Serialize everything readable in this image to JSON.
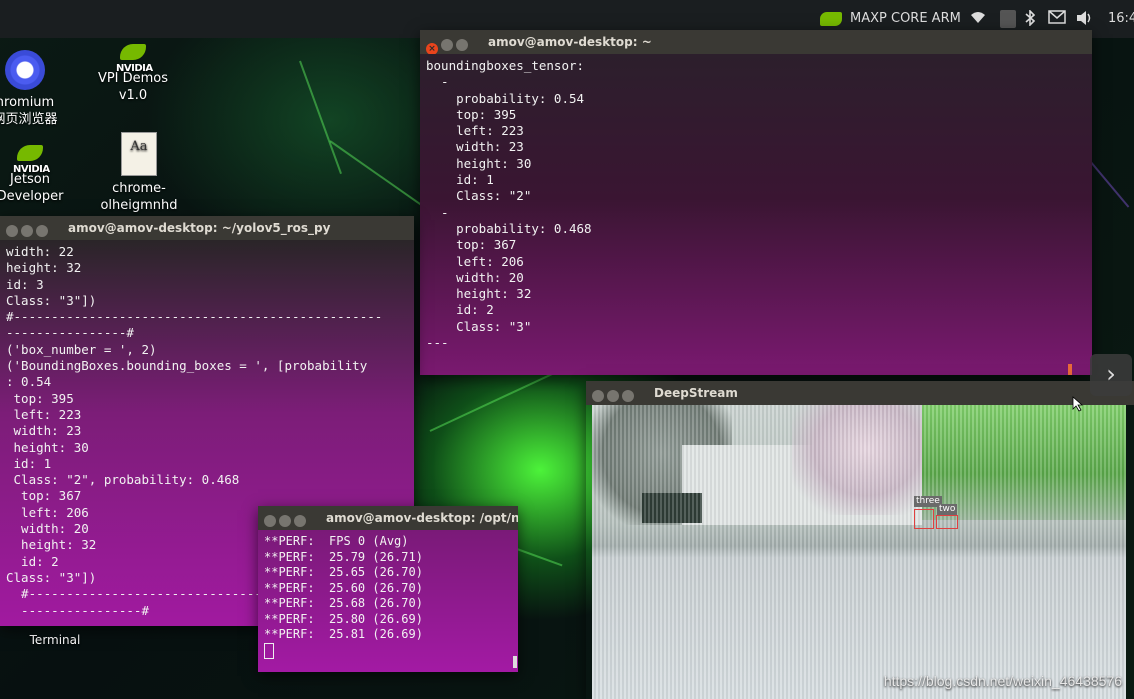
{
  "topbar": {
    "app_label": "MAXP CORE ARM",
    "clock": "16:4"
  },
  "desktop_icons": [
    {
      "label": "hromium\n网页浏览器",
      "icon": "chromium-icon"
    },
    {
      "label": "VPI Demos\nv1.0",
      "icon": "nvidia-icon",
      "logo_text": "NVIDIA"
    },
    {
      "label": "Jetson\nDeveloper",
      "icon": "nvidia-icon",
      "logo_text": "NVIDIA"
    },
    {
      "label": "chrome-\nolheigmnhd",
      "icon": "font-file-icon",
      "glyph_text": "Aa"
    },
    {
      "label": "Terminal",
      "icon": "terminal-icon"
    }
  ],
  "windows": {
    "main": {
      "title": "amov@amov-desktop: ~",
      "content": "boundingboxes_tensor:\n  -\n    probability: 0.54\n    top: 395\n    left: 223\n    width: 23\n    height: 30\n    id: 1\n    Class: \"2\"\n  -\n    probability: 0.468\n    top: 367\n    left: 206\n    width: 20\n    height: 32\n    id: 2\n    Class: \"3\"\n---"
    },
    "ros": {
      "title": "amov@amov-desktop: ~/yolov5_ros_py",
      "content": "width: 22\nheight: 32\nid: 3\nClass: \"3\"])\n#-------------------------------------------------\n----------------#\n('box_number = ', 2)\n('BoundingBoxes.bounding_boxes = ', [probability\n: 0.54\n top: 395\n left: 223\n width: 23\n height: 30\n id: 1\n Class: \"2\", probability: 0.468\n  top: 367\n  left: 206\n  width: 20\n  height: 32\n  id: 2\nClass: \"3\"])\n  #-------------------------------\n  ----------------#"
    },
    "perf": {
      "title": "amov@amov-desktop: /opt/n",
      "content": "**PERF:  FPS 0 (Avg)\n**PERF:  25.79 (26.71)\n**PERF:  25.65 (26.70)\n**PERF:  25.60 (26.70)\n**PERF:  25.68 (26.70)\n**PERF:  25.80 (26.69)\n**PERF:  25.81 (26.69)"
    },
    "deepstream": {
      "title": "DeepStream",
      "detections": [
        "three",
        "two"
      ]
    }
  },
  "watermark": "https://blog.csdn.net/weixin_46438576",
  "colors": {
    "nvidia_green": "#76b900",
    "ubuntu_close": "#e9441c",
    "terminal_purple": "#a11aa0"
  }
}
